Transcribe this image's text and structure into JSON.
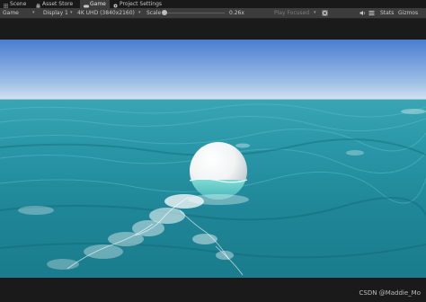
{
  "tabs": [
    {
      "label": "Scene",
      "icon": "grid-icon",
      "active": false
    },
    {
      "label": "Asset Store",
      "icon": "store-icon",
      "active": false
    },
    {
      "label": "Game",
      "icon": "gamepad-icon",
      "active": true
    },
    {
      "label": "Project Settings",
      "icon": "gear-icon",
      "active": false
    }
  ],
  "toolbar": {
    "mode": "Game",
    "display": "Display 1",
    "resolution": "4K UHD (3840x2160)",
    "scale_label": "Scale",
    "scale_value": "0.26x",
    "play_mode": "Play Focused",
    "stats": "Stats",
    "gizmos": "Gizmos"
  },
  "watermark": "CSDN @Maddie_Mo",
  "colors": {
    "sky_top": "#4a7cd0",
    "sky_horizon": "#d4e3ef",
    "ocean_far": "#3aa6b4",
    "ocean_near": "#1a7c8c",
    "foam": "#ffffff",
    "editor_bg": "#3c3c3c"
  }
}
